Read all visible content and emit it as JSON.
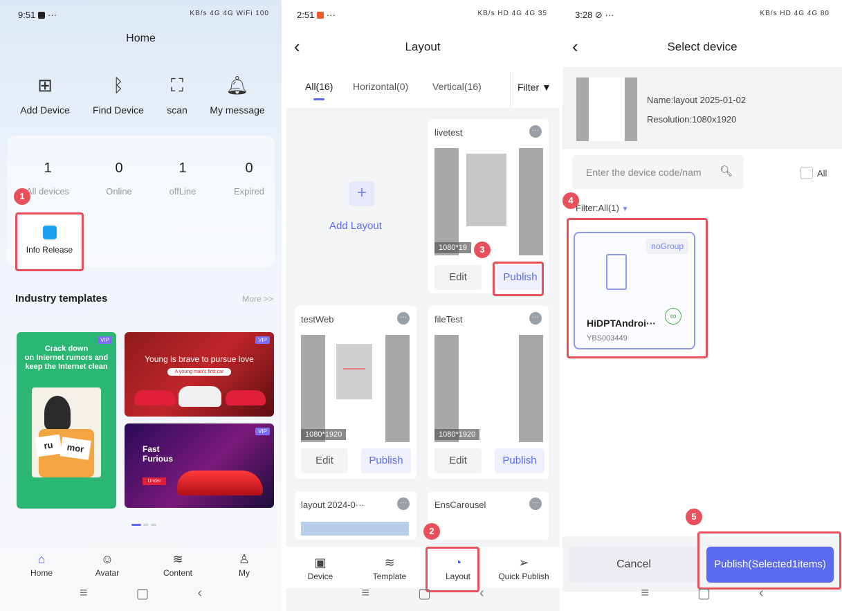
{
  "panel1": {
    "status_time": "9:51",
    "status_icons": "KB/s 4G 4G WiFi 100",
    "title": "Home",
    "quick_actions": [
      {
        "label": "Add Device",
        "icon": "add-device-icon"
      },
      {
        "label": "Find Device",
        "icon": "bluetooth-icon"
      },
      {
        "label": "scan",
        "icon": "scan-icon"
      },
      {
        "label": "My message",
        "icon": "bell-icon"
      }
    ],
    "stats": [
      {
        "value": "1",
        "label": "All devices"
      },
      {
        "value": "0",
        "label": "Online"
      },
      {
        "value": "1",
        "label": "offLine"
      },
      {
        "value": "0",
        "label": "Expired"
      }
    ],
    "info_release_label": "Info Release",
    "templates_title": "Industry templates",
    "more_label": "More >>",
    "templates": [
      {
        "line1": "Crack down",
        "line2": "on Internet rumors and",
        "line3": "keep the Internet clean",
        "word1": "ru",
        "word2": "mor",
        "vip": "VIP"
      },
      {
        "line1": "Young is brave to pursue love",
        "line2": "A young man's first car",
        "vip": "VIP"
      },
      {
        "line1": "Fast",
        "line2": "Furious",
        "line3": "Under",
        "vip": "VIP"
      }
    ],
    "tabs": [
      {
        "label": "Home",
        "icon": "home-icon"
      },
      {
        "label": "Avatar",
        "icon": "avatar-icon"
      },
      {
        "label": "Content",
        "icon": "layers-icon"
      },
      {
        "label": "My",
        "icon": "user-icon"
      }
    ]
  },
  "panel2": {
    "status_time": "2:51",
    "status_icons": "KB/s HD 4G 4G 35",
    "title": "Layout",
    "filter_tabs": [
      {
        "label": "All(16)"
      },
      {
        "label": "Horizontal(0)"
      },
      {
        "label": "Vertical(16)"
      }
    ],
    "filter_label": "Filter",
    "add_layout_label": "Add Layout",
    "layouts": [
      {
        "name": "livetest",
        "resolution": "1080*19",
        "edit": "Edit",
        "publish": "Publish"
      },
      {
        "name": "testWeb",
        "resolution": "1080*1920",
        "edit": "Edit",
        "publish": "Publish"
      },
      {
        "name": "fileTest",
        "resolution": "1080*1920",
        "edit": "Edit",
        "publish": "Publish"
      },
      {
        "name": "layout 2024-0···"
      },
      {
        "name": "EnsCarousel"
      }
    ],
    "tabs": [
      {
        "label": "Device",
        "icon": "device-icon"
      },
      {
        "label": "Template",
        "icon": "layers-icon"
      },
      {
        "label": "Layout",
        "icon": "layout-icon"
      },
      {
        "label": "Quick Publish",
        "icon": "send-icon"
      }
    ]
  },
  "panel3": {
    "status_time": "3:28",
    "status_icons": "KB/s HD 4G 4G 80",
    "title": "Select device",
    "layout_name": "Name:layout 2025-01-02",
    "layout_resolution": "Resolution:1080x1920",
    "search_placeholder": "Enter the device code/nam",
    "all_label": "All",
    "filter_label": "Filter:All(1)",
    "device": {
      "group": "noGroup",
      "name": "HiDPTAndroi···",
      "code": "YBS003449"
    },
    "cancel_label": "Cancel",
    "publish_label": "Publish(Selected1items)"
  },
  "steps": [
    "1",
    "2",
    "3",
    "4",
    "5"
  ],
  "colors": {
    "accent": "#5b6bf0",
    "highlight": "#e8505b",
    "link_green": "#4caf50"
  }
}
